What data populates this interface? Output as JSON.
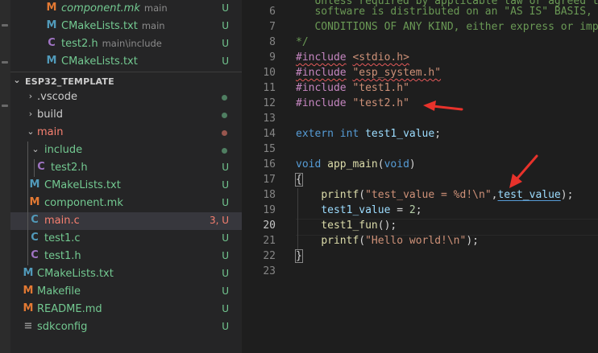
{
  "explorer": {
    "top_items": [
      {
        "name": "component.mk",
        "sub": "main",
        "status": "U",
        "icon": "M",
        "italic": true
      },
      {
        "name": "CMakeLists.txt",
        "sub": "main",
        "status": "U",
        "icon": "M"
      },
      {
        "name": "test2.h",
        "sub": "main\\include",
        "status": "U",
        "icon": "C"
      },
      {
        "name": "CMakeLists.txt",
        "sub": "",
        "status": "U",
        "icon": "M"
      }
    ],
    "section_title": "ESP32_TEMPLATE",
    "tree": {
      "vscode": {
        "name": ".vscode"
      },
      "build": {
        "name": "build"
      },
      "main": {
        "name": "main"
      },
      "include": {
        "name": "include"
      },
      "test2h": {
        "name": "test2.h",
        "status": "U",
        "icon": "C"
      },
      "main_cmake": {
        "name": "CMakeLists.txt",
        "status": "U",
        "icon": "M"
      },
      "component_mk": {
        "name": "component.mk",
        "status": "U",
        "icon": "M"
      },
      "main_c": {
        "name": "main.c",
        "status": "3, U",
        "icon": "C"
      },
      "test1_c": {
        "name": "test1.c",
        "status": "U",
        "icon": "C"
      },
      "test1_h": {
        "name": "test1.h",
        "status": "U",
        "icon": "C"
      },
      "root_cmake": {
        "name": "CMakeLists.txt",
        "status": "U",
        "icon": "M"
      },
      "makefile": {
        "name": "Makefile",
        "status": "U",
        "icon": "M"
      },
      "readme": {
        "name": "README.md",
        "status": "U",
        "icon": "M"
      },
      "sdkconfig": {
        "name": "sdkconfig",
        "status": "U",
        "icon": "≡"
      }
    }
  },
  "editor": {
    "line_numbers": [
      "6",
      "7",
      "8",
      "9",
      "10",
      "11",
      "12",
      "13",
      "14",
      "15",
      "16",
      "17",
      "18",
      "19",
      "20",
      "21",
      "22",
      "23"
    ],
    "partial_line": "   Unless required by applicable law or agreed to",
    "l6": "   software is distributed on an \"AS IS\" BASIS, W",
    "l7": "   CONDITIONS OF ANY KIND, either express or impl",
    "l8": "*/",
    "l9_kw": "#include",
    "l9_arg": "<stdio.h>",
    "l10_kw": "#include",
    "l10_arg": "\"esp_system.h\"",
    "l11_kw": "#include",
    "l11_arg": "\"test1.h\"",
    "l12_kw": "#include",
    "l12_arg": "\"test2.h\"",
    "l14_a": "extern",
    "l14_b": "int",
    "l14_c": "test1_value",
    "l14_d": ";",
    "l16_a": "void",
    "l16_b": "app_main",
    "l16_c": "(",
    "l16_d": "void",
    "l16_e": ")",
    "l17": "{",
    "l18_fn": "printf",
    "l18_open": "(",
    "l18_str": "\"test_value = %d!\\n\"",
    "l18_comma": ",",
    "l18_var": "test_value",
    "l18_close": ");",
    "l19_var": "test1_value",
    "l19_eq": " = ",
    "l19_num": "2",
    "l19_end": ";",
    "l20_fn": "test1_fun",
    "l20_end": "();",
    "l21_fn": "printf",
    "l21_open": "(",
    "l21_str": "\"Hello world!\\n\"",
    "l21_close": ");",
    "l22": "}"
  },
  "colors": {
    "annotation_arrow": "#e8322b"
  }
}
